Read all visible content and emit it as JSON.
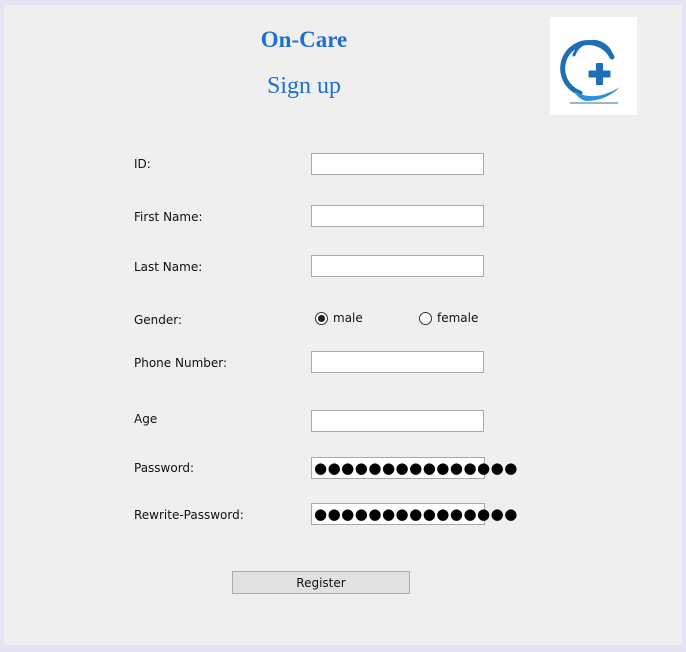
{
  "header": {
    "app_title": "On-Care",
    "page_title": "Sign up"
  },
  "logo": {
    "icon": "medical-cross-hand-icon"
  },
  "form": {
    "id_label": "ID:",
    "first_name_label": "First Name:",
    "last_name_label": "Last Name:",
    "gender_label": "Gender:",
    "gender_options": [
      "male",
      "female"
    ],
    "gender_selected": "male",
    "phone_label": "Phone Number:",
    "age_label": "Age",
    "password_label": "Password:",
    "password_value": "●●●●●●●●●●●●●●●",
    "rewrite_password_label": "Rewrite-Password:",
    "rewrite_password_value": "●●●●●●●●●●●●●●●",
    "register_button": "Register"
  },
  "colors": {
    "title": "#1f6fcf",
    "logo_blue": "#1e6fb8"
  }
}
